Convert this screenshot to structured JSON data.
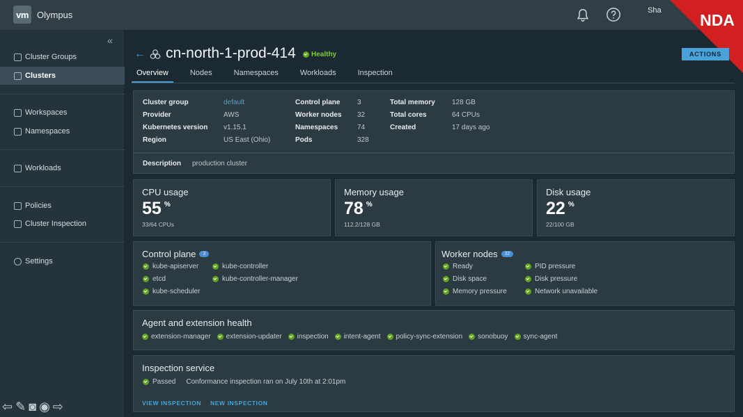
{
  "app": {
    "logo": "vm",
    "name": "Olympus",
    "user": "Sha",
    "watermark": "NDA"
  },
  "header": {
    "bell_icon": "bell-icon",
    "help_icon": "help-icon"
  },
  "sidebar": {
    "collapse": "«",
    "items": [
      {
        "label": "Cluster Groups",
        "icon": "cluster-groups-icon"
      },
      {
        "label": "Clusters",
        "icon": "clusters-icon",
        "active": true
      },
      {
        "label": "Workspaces",
        "icon": "workspaces-icon"
      },
      {
        "label": "Namespaces",
        "icon": "namespaces-icon"
      },
      {
        "label": "Workloads",
        "icon": "workloads-icon"
      },
      {
        "label": "Policies",
        "icon": "policies-icon"
      },
      {
        "label": "Cluster Inspection",
        "icon": "inspection-icon"
      },
      {
        "label": "Settings",
        "icon": "settings-icon"
      }
    ]
  },
  "page": {
    "title": "cn-north-1-prod-414",
    "status": "Healthy",
    "actions": "ACTIONS",
    "tabs": [
      "Overview",
      "Nodes",
      "Namespaces",
      "Workloads",
      "Inspection"
    ]
  },
  "details": {
    "col1": [
      {
        "k": "Cluster group",
        "v": "default"
      },
      {
        "k": "Provider",
        "v": "AWS"
      },
      {
        "k": "Kubernetes version",
        "v": "v1.15.1"
      },
      {
        "k": "Region",
        "v": "US East (Ohio)"
      }
    ],
    "col2": [
      {
        "k": "Control plane",
        "v": "3"
      },
      {
        "k": "Worker nodes",
        "v": "32"
      },
      {
        "k": "Namespaces",
        "v": "74"
      },
      {
        "k": "Pods",
        "v": "328"
      }
    ],
    "col3": [
      {
        "k": "Total memory",
        "v": "128 GB"
      },
      {
        "k": "Total cores",
        "v": "64 CPUs"
      },
      {
        "k": "Created",
        "v": "17 days ago"
      }
    ],
    "description_label": "Description",
    "description": "production cluster"
  },
  "metrics": [
    {
      "title": "CPU usage",
      "value": "55",
      "unit": "%",
      "sub": "33/64 CPUs"
    },
    {
      "title": "Memory usage",
      "value": "78",
      "unit": "%",
      "sub": "112.2/128 GB"
    },
    {
      "title": "Disk usage",
      "value": "22",
      "unit": "%",
      "sub": "22/100 GB"
    }
  ],
  "control_plane": {
    "title": "Control plane",
    "count": "3",
    "items": [
      "kube-apiserver",
      "etcd",
      "kube-scheduler",
      "kube-controller",
      "kube-controller-manager"
    ]
  },
  "worker_nodes": {
    "title": "Worker nodes",
    "count": "32",
    "items": [
      "Ready",
      "Disk space",
      "Memory pressure",
      "PID pressure",
      "Disk pressure",
      "Network unavailable"
    ]
  },
  "agents": {
    "title": "Agent and extension health",
    "items": [
      "extension-manager",
      "extension-updater",
      "inspection",
      "intent-agent",
      "policy-sync-extension",
      "sonobuoy",
      "sync-agent"
    ]
  },
  "inspection": {
    "title": "Inspection service",
    "status": "Passed",
    "message": "Conformance inspection ran on July 10th at 2:01pm",
    "view": "VIEW INSPECTION",
    "new": "NEW INSPECTION"
  }
}
